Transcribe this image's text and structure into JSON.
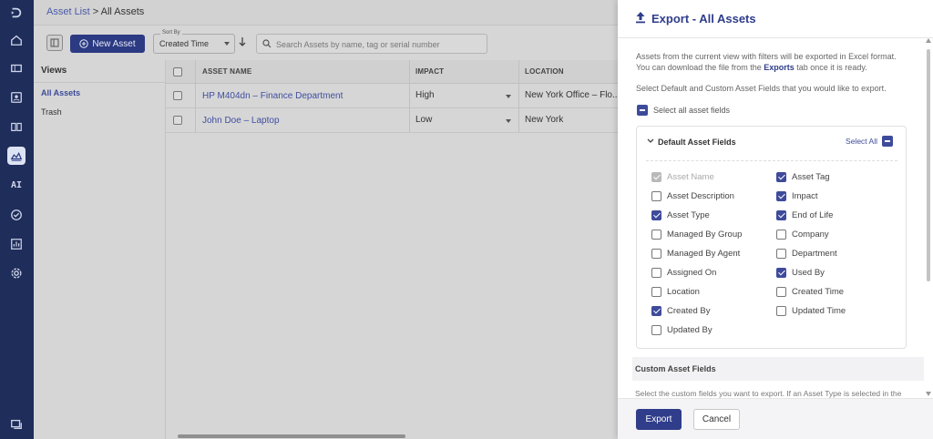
{
  "rail": {
    "items": [
      {
        "name": "logo-icon"
      },
      {
        "name": "home-icon"
      },
      {
        "name": "tickets-icon"
      },
      {
        "name": "contacts-icon"
      },
      {
        "name": "knowledge-book-icon"
      },
      {
        "name": "assets-icon"
      },
      {
        "name": "ai-icon",
        "label": "AI"
      },
      {
        "name": "tasks-check-icon"
      },
      {
        "name": "reports-icon"
      },
      {
        "name": "settings-icon"
      },
      {
        "name": "chat-icon"
      }
    ]
  },
  "header": {
    "breadcrumb_link": "Asset List",
    "breadcrumb_sep": " > ",
    "breadcrumb_current": "All Assets"
  },
  "toolbar": {
    "new_asset_label": "New Asset",
    "sort_label": "Sort By",
    "sort_value": "Created Time",
    "search_placeholder": "Search Assets by name, tag or serial number"
  },
  "views": {
    "heading": "Views",
    "items": [
      "All Assets",
      "Trash"
    ]
  },
  "table": {
    "columns": [
      "ASSET NAME",
      "IMPACT",
      "LOCATION"
    ],
    "rows": [
      {
        "name": "HP M404dn – Finance Department",
        "impact": "High",
        "location": "New York Office – Flo..."
      },
      {
        "name": "John Doe – Laptop",
        "impact": "Low",
        "location": "New York"
      }
    ]
  },
  "drawer": {
    "title": "Export - All Assets",
    "intro_before": "Assets from the current view with filters will be exported in Excel format. You can download the file from the ",
    "intro_link": "Exports",
    "intro_after": " tab once it is ready.",
    "intro2": "Select Default and Custom Asset Fields that you would like to export.",
    "select_all_fields": "Select all asset fields",
    "default_section": {
      "title": "Default Asset Fields",
      "select_all": "Select All",
      "left": [
        {
          "label": "Asset Name",
          "checked": true,
          "disabled": true
        },
        {
          "label": "Asset Description",
          "checked": false
        },
        {
          "label": "Asset Type",
          "checked": true
        },
        {
          "label": "Managed By Group",
          "checked": false
        },
        {
          "label": "Managed By Agent",
          "checked": false
        },
        {
          "label": "Assigned On",
          "checked": false
        },
        {
          "label": "Location",
          "checked": false
        },
        {
          "label": "Created By",
          "checked": true
        },
        {
          "label": "Updated By",
          "checked": false
        }
      ],
      "right": [
        {
          "label": "Asset Tag",
          "checked": true
        },
        {
          "label": "Impact",
          "checked": true
        },
        {
          "label": "End of Life",
          "checked": true
        },
        {
          "label": "Company",
          "checked": false
        },
        {
          "label": "Department",
          "checked": false
        },
        {
          "label": "Used By",
          "checked": true
        },
        {
          "label": "Created Time",
          "checked": false
        },
        {
          "label": "Updated Time",
          "checked": false
        }
      ]
    },
    "custom_section_title": "Custom Asset Fields",
    "custom_desc": "Select the custom fields you want to export. If an Asset Type is selected in the",
    "export_label": "Export",
    "cancel_label": "Cancel"
  }
}
